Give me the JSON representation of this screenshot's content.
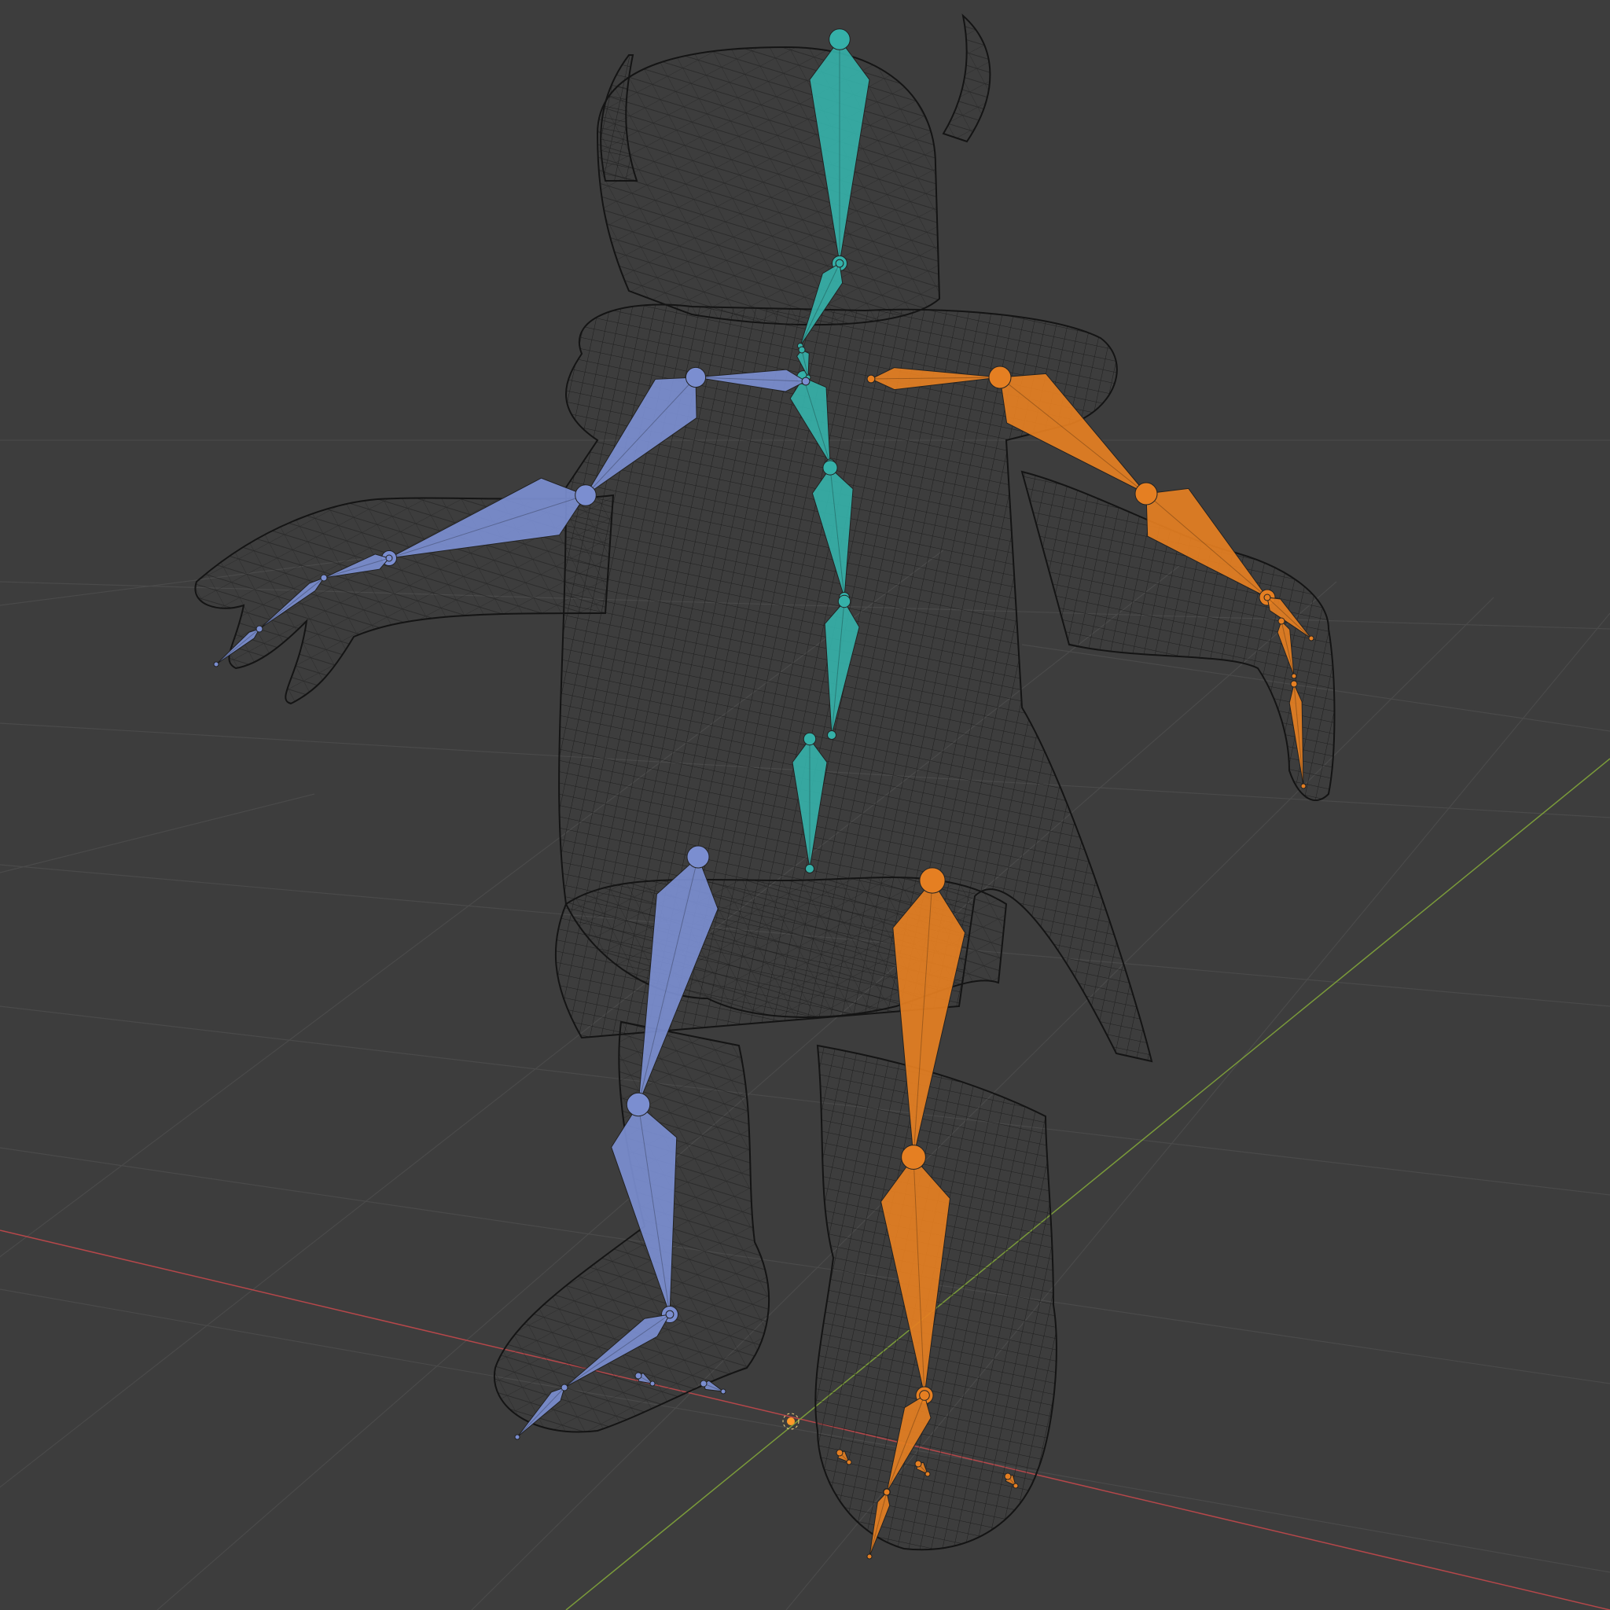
{
  "viewport": {
    "name": "3d-viewport",
    "shading": "wireframe",
    "background": "#3d3d3d"
  },
  "colors": {
    "grid": "#4a4a4a",
    "x_axis": "#b5474a",
    "y_axis": "#7a9a3a",
    "wire": "#141414",
    "spine": "#35b0a8",
    "left_side": "#7b8ed0",
    "right_side": "#e57f22"
  },
  "armature": {
    "bone_groups": [
      {
        "name": "spine",
        "bone_count": 7
      },
      {
        "name": "left-arm",
        "bone_count": 6
      },
      {
        "name": "right-arm",
        "bone_count": 6
      },
      {
        "name": "left-leg",
        "bone_count": 4
      },
      {
        "name": "right-leg",
        "bone_count": 4
      }
    ]
  },
  "object": {
    "type": "mesh",
    "icon": "origin-cursor-icon"
  }
}
